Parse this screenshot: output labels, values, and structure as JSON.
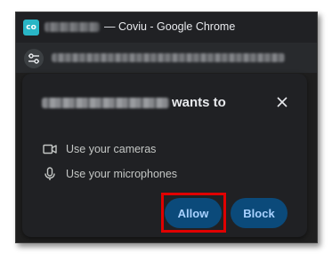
{
  "window": {
    "app_icon_text": "co",
    "title": "— Coviu - Google Chrome"
  },
  "dialog": {
    "heading_suffix": "wants to",
    "permissions": [
      {
        "icon": "camera-icon",
        "label": "Use your cameras"
      },
      {
        "icon": "microphone-icon",
        "label": "Use your microphones"
      }
    ],
    "allow_label": "Allow",
    "block_label": "Block"
  },
  "colors": {
    "accent_button_bg": "#0b4a7a",
    "accent_button_text": "#a8d1ff",
    "highlight": "#e00000"
  }
}
